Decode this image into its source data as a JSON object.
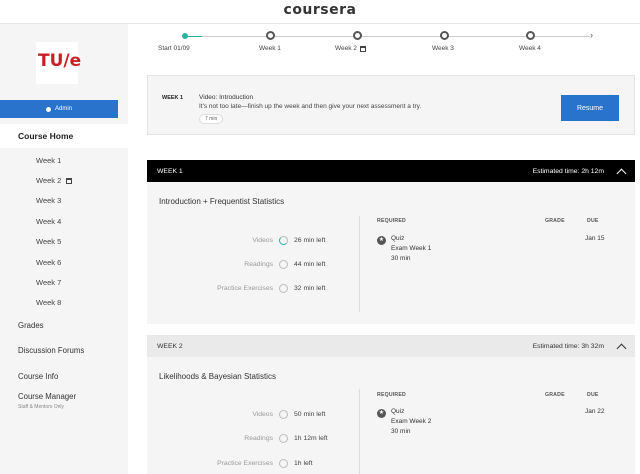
{
  "header": {
    "brand": "coursera"
  },
  "sidebar": {
    "logo_text": "TU/e",
    "admin_label": "Admin",
    "home_label": "Course Home",
    "weeks": [
      {
        "label": "Week 1"
      },
      {
        "label": "Week 2",
        "calendar": true
      },
      {
        "label": "Week 3"
      },
      {
        "label": "Week 4"
      },
      {
        "label": "Week 5"
      },
      {
        "label": "Week 6"
      },
      {
        "label": "Week 7"
      },
      {
        "label": "Week 8"
      }
    ],
    "grades": "Grades",
    "forums": "Discussion Forums",
    "info": "Course Info",
    "manager": "Course Manager",
    "manager_sub": "Staff & Mentors Only"
  },
  "timeline": {
    "labels": [
      "Start 01/09",
      "Week 1",
      "Week 2",
      "Week 3",
      "Week 4"
    ],
    "arrow": "›"
  },
  "resume": {
    "week": "WEEK 1",
    "title": "Video: Introduction",
    "message": "It's not too late—finish up the week and then give your next assessment a try.",
    "duration": "7 min",
    "button": "Resume"
  },
  "weeks": [
    {
      "header": "WEEK 1",
      "estimate": "Estimated time: 2h 12m",
      "title": "Introduction + Frequentist Statistics",
      "stats": [
        {
          "label": "Videos",
          "value": "26 min left",
          "partial": true
        },
        {
          "label": "Readings",
          "value": "44 min left",
          "partial": false
        },
        {
          "label": "Practice Exercises",
          "value": "32 min left",
          "partial": false
        }
      ],
      "col_required": "REQUIRED",
      "col_grade": "GRADE",
      "col_due": "DUE",
      "quiz_type": "Quiz",
      "quiz_name": "Exam Week 1",
      "quiz_time": "30 min",
      "due": "Jan 15"
    },
    {
      "header": "WEEK 2",
      "estimate": "Estimated time: 3h 32m",
      "title": "Likelihoods & Bayesian Statistics",
      "stats": [
        {
          "label": "Videos",
          "value": "50 min left",
          "partial": false
        },
        {
          "label": "Readings",
          "value": "1h 12m left",
          "partial": false
        },
        {
          "label": "Practice Exercises",
          "value": "1h left",
          "partial": false
        }
      ],
      "col_required": "REQUIRED",
      "col_grade": "GRADE",
      "col_due": "DUE",
      "quiz_type": "Quiz",
      "quiz_name": "Exam Week 2",
      "quiz_time": "30 min",
      "due": "Jan 22"
    }
  ],
  "colors": {
    "accent": "#2a73cc",
    "progress": "#2bb3a0",
    "brand_red": "#c72125"
  }
}
